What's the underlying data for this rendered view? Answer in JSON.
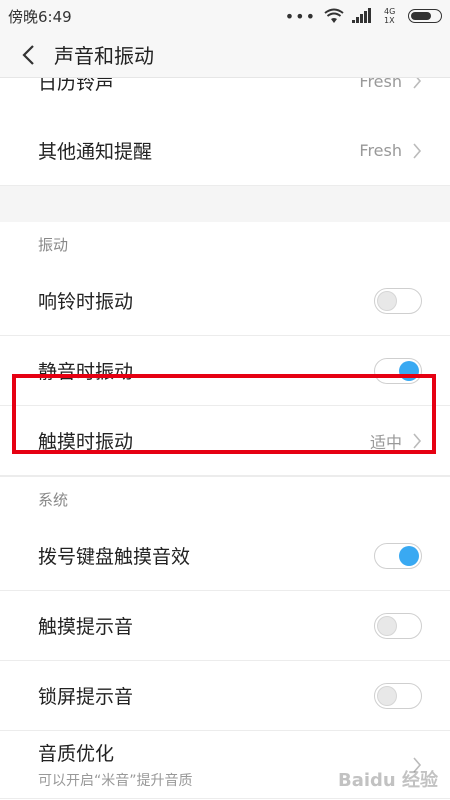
{
  "status": {
    "time": "傍晚6:49",
    "signal_text": "4G 1X"
  },
  "header": {
    "title": "声音和振动"
  },
  "clipped_row": {
    "label": "日历铃声",
    "value": "Fresh"
  },
  "rows_top": [
    {
      "label": "其他通知提醒",
      "value": "Fresh"
    }
  ],
  "sections": {
    "vibration": {
      "title": "振动",
      "rows": [
        {
          "label": "响铃时振动",
          "toggle": "off"
        },
        {
          "label": "静音时振动",
          "toggle": "on"
        },
        {
          "label": "触摸时振动",
          "value": "适中"
        }
      ]
    },
    "system": {
      "title": "系统",
      "rows": [
        {
          "label": "拨号键盘触摸音效",
          "toggle": "on"
        },
        {
          "label": "触摸提示音",
          "toggle": "off"
        },
        {
          "label": "锁屏提示音",
          "toggle": "off"
        },
        {
          "label": "音质优化",
          "sub": "可以开启“米音”提升音质"
        }
      ]
    }
  },
  "colors": {
    "accent": "#39a9f2",
    "highlight": "#e60012"
  },
  "watermark": "Baidu 经验"
}
